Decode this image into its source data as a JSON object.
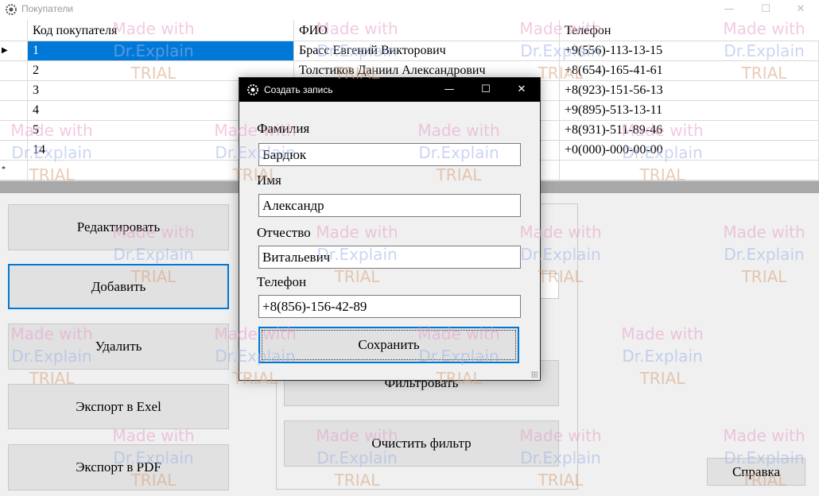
{
  "window": {
    "title": "Покупатели",
    "icon": "gear-icon",
    "minimize": "—",
    "maximize": "☐",
    "close": "✕"
  },
  "grid": {
    "columns": [
      "Код покупателя",
      "ФИО",
      "Телефон"
    ],
    "rows": [
      {
        "indicator": "▶",
        "id": "1",
        "fio": "Брасс Евгений Викторович",
        "phone": "+9(556)-113-13-15"
      },
      {
        "indicator": "",
        "id": "2",
        "fio": "Толстиков Даниил Александрович",
        "phone": "+8(654)-165-41-61"
      },
      {
        "indicator": "",
        "id": "3",
        "fio": "",
        "phone": "+8(923)-151-56-13"
      },
      {
        "indicator": "",
        "id": "4",
        "fio": "",
        "phone": "+9(895)-513-13-11"
      },
      {
        "indicator": "",
        "id": "5",
        "fio": "",
        "phone": "+8(931)-511-89-46"
      },
      {
        "indicator": "",
        "id": "14",
        "fio": "",
        "phone": "+0(000)-000-00-00"
      },
      {
        "indicator": "*",
        "id": "",
        "fio": "",
        "phone": ""
      }
    ]
  },
  "buttons": {
    "edit": "Редактировать",
    "add": "Добавить",
    "delete": "Удалить",
    "export_excel": "Экспорт в Exel",
    "export_pdf": "Экспорт в PDF",
    "filter": "Фильтровать",
    "clear_filter": "Очистить фильтр",
    "help": "Справка"
  },
  "dialog": {
    "title": "Создать запись",
    "icon": "gear-icon",
    "minimize": "—",
    "maximize": "☐",
    "close": "✕",
    "fields": {
      "surname": {
        "label": "Фамилия",
        "value": "Бардюк"
      },
      "name": {
        "label": "Имя",
        "value": "Александр"
      },
      "patronymic": {
        "label": "Отчество",
        "value": "Витальевич"
      },
      "phone": {
        "label": "Телефон",
        "value": "+8(856)-156-42-89"
      }
    },
    "save": "Сохранить"
  },
  "watermark": {
    "line1": "Made with",
    "line2": "Dr.Explain",
    "line3": "TRIAL"
  },
  "colors": {
    "selection": "#0078d7",
    "dialog_titlebar": "#000000",
    "splitter": "#a8a8a8"
  }
}
